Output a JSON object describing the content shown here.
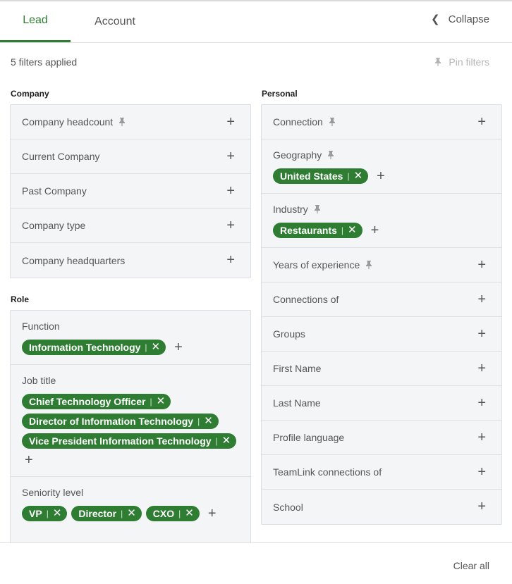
{
  "tabs": {
    "lead": "Lead",
    "account": "Account",
    "collapse": "Collapse"
  },
  "summary": "5 filters applied",
  "pin_filters": "Pin filters",
  "accent_color": "#2e7d32",
  "sections": {
    "company": "Company",
    "role": "Role",
    "personal": "Personal"
  },
  "company": {
    "headcount": "Company headcount",
    "current": "Current Company",
    "past": "Past Company",
    "type": "Company type",
    "hq": "Company headquarters"
  },
  "role": {
    "function": {
      "label": "Function",
      "chips": [
        "Information Technology"
      ]
    },
    "job_title": {
      "label": "Job title",
      "chips": [
        "Chief Technology Officer",
        "Director of Information Technology",
        "Vice President Information Technology"
      ]
    },
    "seniority": {
      "label": "Seniority level",
      "chips": [
        "VP",
        "Director",
        "CXO"
      ]
    }
  },
  "personal": {
    "connection": "Connection",
    "geography": {
      "label": "Geography",
      "chips": [
        "United States"
      ]
    },
    "industry": {
      "label": "Industry",
      "chips": [
        "Restaurants"
      ]
    },
    "years": "Years of experience",
    "connections_of": "Connections of",
    "groups": "Groups",
    "first_name": "First Name",
    "last_name": "Last Name",
    "profile_language": "Profile language",
    "teamlink": "TeamLink connections of",
    "school": "School"
  },
  "icons": {
    "plus": "+",
    "close": "✕",
    "chevron": "❮",
    "pin": "pin-icon"
  },
  "footer": {
    "clear_all": "Clear all"
  }
}
